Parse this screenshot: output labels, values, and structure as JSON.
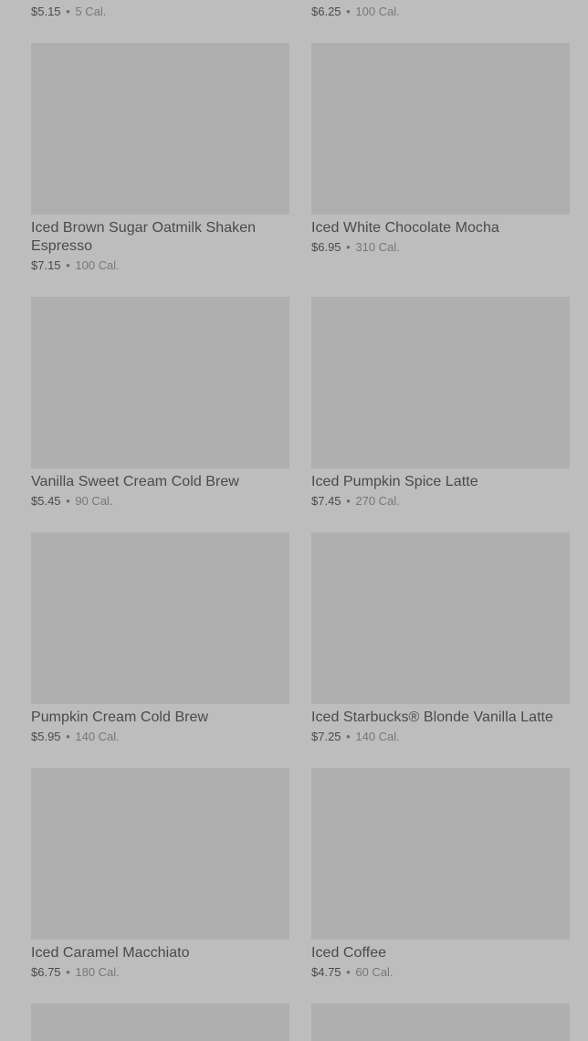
{
  "menu": {
    "items": [
      {
        "name": "",
        "price": "$5.15",
        "calories": "5 Cal."
      },
      {
        "name": "",
        "price": "$6.25",
        "calories": "100 Cal."
      },
      {
        "name": "Iced Brown Sugar Oatmilk Shaken Espresso",
        "price": "$7.15",
        "calories": "100 Cal."
      },
      {
        "name": "Iced White Chocolate Mocha",
        "price": "$6.95",
        "calories": "310 Cal."
      },
      {
        "name": "Vanilla Sweet Cream Cold Brew",
        "price": "$5.45",
        "calories": "90 Cal."
      },
      {
        "name": "Iced Pumpkin Spice Latte",
        "price": "$7.45",
        "calories": "270 Cal."
      },
      {
        "name": "Pumpkin Cream Cold Brew",
        "price": "$5.95",
        "calories": "140 Cal."
      },
      {
        "name": "Iced Starbucks® Blonde Vanilla Latte",
        "price": "$7.25",
        "calories": "140 Cal."
      },
      {
        "name": "Iced Caramel Macchiato",
        "price": "$6.75",
        "calories": "180 Cal."
      },
      {
        "name": "Iced Coffee",
        "price": "$4.75",
        "calories": "60 Cal."
      },
      {
        "name": "",
        "price": "",
        "calories": ""
      },
      {
        "name": "",
        "price": "",
        "calories": ""
      }
    ],
    "separator": "•"
  }
}
